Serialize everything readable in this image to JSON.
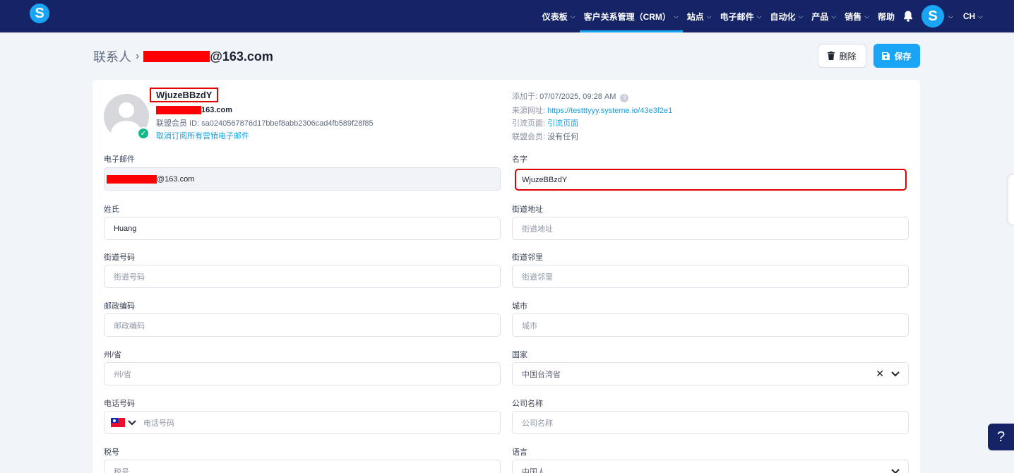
{
  "nav": {
    "logo": "S",
    "items": [
      {
        "label": "仪表板",
        "chevron": true,
        "active": false
      },
      {
        "label": "客户关系管理（CRM）",
        "chevron": true,
        "active": true
      },
      {
        "label": "站点",
        "chevron": true,
        "active": false
      },
      {
        "label": "电子邮件",
        "chevron": true,
        "active": false
      },
      {
        "label": "自动化",
        "chevron": true,
        "active": false
      },
      {
        "label": "产品",
        "chevron": true,
        "active": false
      },
      {
        "label": "销售",
        "chevron": true,
        "active": false
      },
      {
        "label": "帮助",
        "chevron": false,
        "active": false
      }
    ],
    "avatar": "S",
    "language": "CH"
  },
  "breadcrumb": {
    "root": "联系人",
    "email_suffix": "@163.com"
  },
  "actions": {
    "delete_label": "删除",
    "save_label": "保存"
  },
  "contact": {
    "name": "WjuzeBBzdY",
    "email_suffix": "163.com",
    "affiliate_id": "联盟会员 ID: sa0240567876d17bbef8abb2306cad4fb589f28f85",
    "unsubscribe": "取消订阅所有营销电子邮件"
  },
  "meta": {
    "added_label": "添加于:",
    "added_value": "07/07/2025, 09:28 AM",
    "source_label": "来源网址:",
    "source_value": "https://testttyyy.systeme.io/43e3f2e1",
    "referral_label": "引流页面:",
    "referral_value": "引流页面",
    "affiliate_label": "联盟会员:",
    "affiliate_value": "没有任何"
  },
  "form": {
    "email_label": "电子邮件",
    "email_suffix": "@163.com",
    "first_name_label": "名字",
    "first_name_value": "WjuzeBBzdY",
    "last_name_label": "姓氏",
    "last_name_value": "Huang",
    "street_address_label": "街道地址",
    "street_address_placeholder": "街道地址",
    "street_number_label": "街道号码",
    "street_number_placeholder": "街道号码",
    "neighborhood_label": "街道邻里",
    "neighborhood_placeholder": "街道邻里",
    "postal_code_label": "邮政编码",
    "postal_code_placeholder": "邮政编码",
    "city_label": "城市",
    "city_placeholder": "城市",
    "state_label": "州/省",
    "state_placeholder": "州/省",
    "country_label": "国家",
    "country_value": "中国台湾省",
    "phone_label": "电话号码",
    "phone_placeholder": "电话号码",
    "company_label": "公司名称",
    "company_placeholder": "公司名称",
    "tax_label": "税号",
    "tax_placeholder": "税号",
    "language_label": "语言",
    "language_value": "中国人"
  },
  "help_label": "?"
}
